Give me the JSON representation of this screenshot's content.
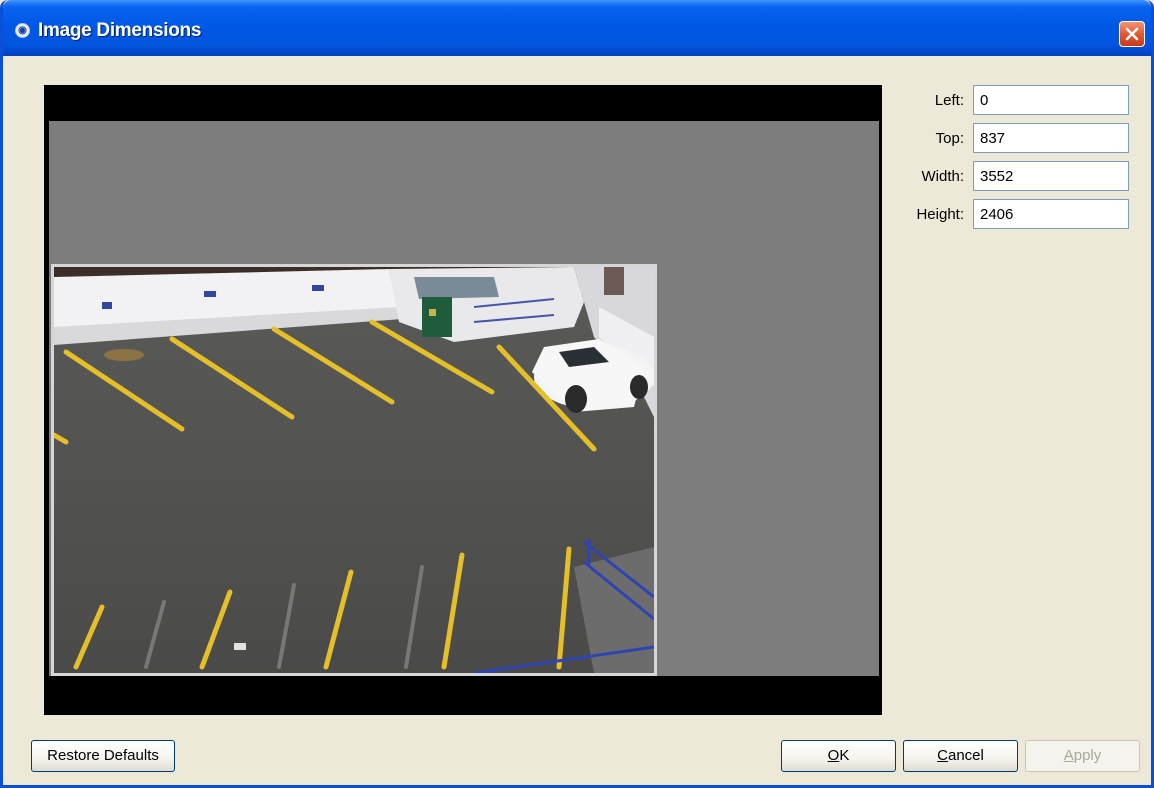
{
  "window": {
    "title": "Image Dimensions",
    "title_icon": "dialog-app-icon",
    "close_icon": "close-icon"
  },
  "fields": {
    "left": {
      "label": "Left:",
      "value": "0"
    },
    "top": {
      "label": "Top:",
      "value": "837"
    },
    "width": {
      "label": "Width:",
      "value": "3552"
    },
    "height": {
      "label": "Height:",
      "value": "2406"
    }
  },
  "buttons": {
    "restore_defaults": "Restore Defaults",
    "ok_mnemonic": "O",
    "ok_rest": "K",
    "cancel_mnemonic": "C",
    "cancel_rest": "ancel",
    "apply_mnemonic": "A",
    "apply_rest": "pply"
  },
  "colors": {
    "titlebar": "#0058e6",
    "dialog_bg": "#ece9d8",
    "preview_bg": "#000000",
    "canvas_bg": "#7d7d7d"
  }
}
